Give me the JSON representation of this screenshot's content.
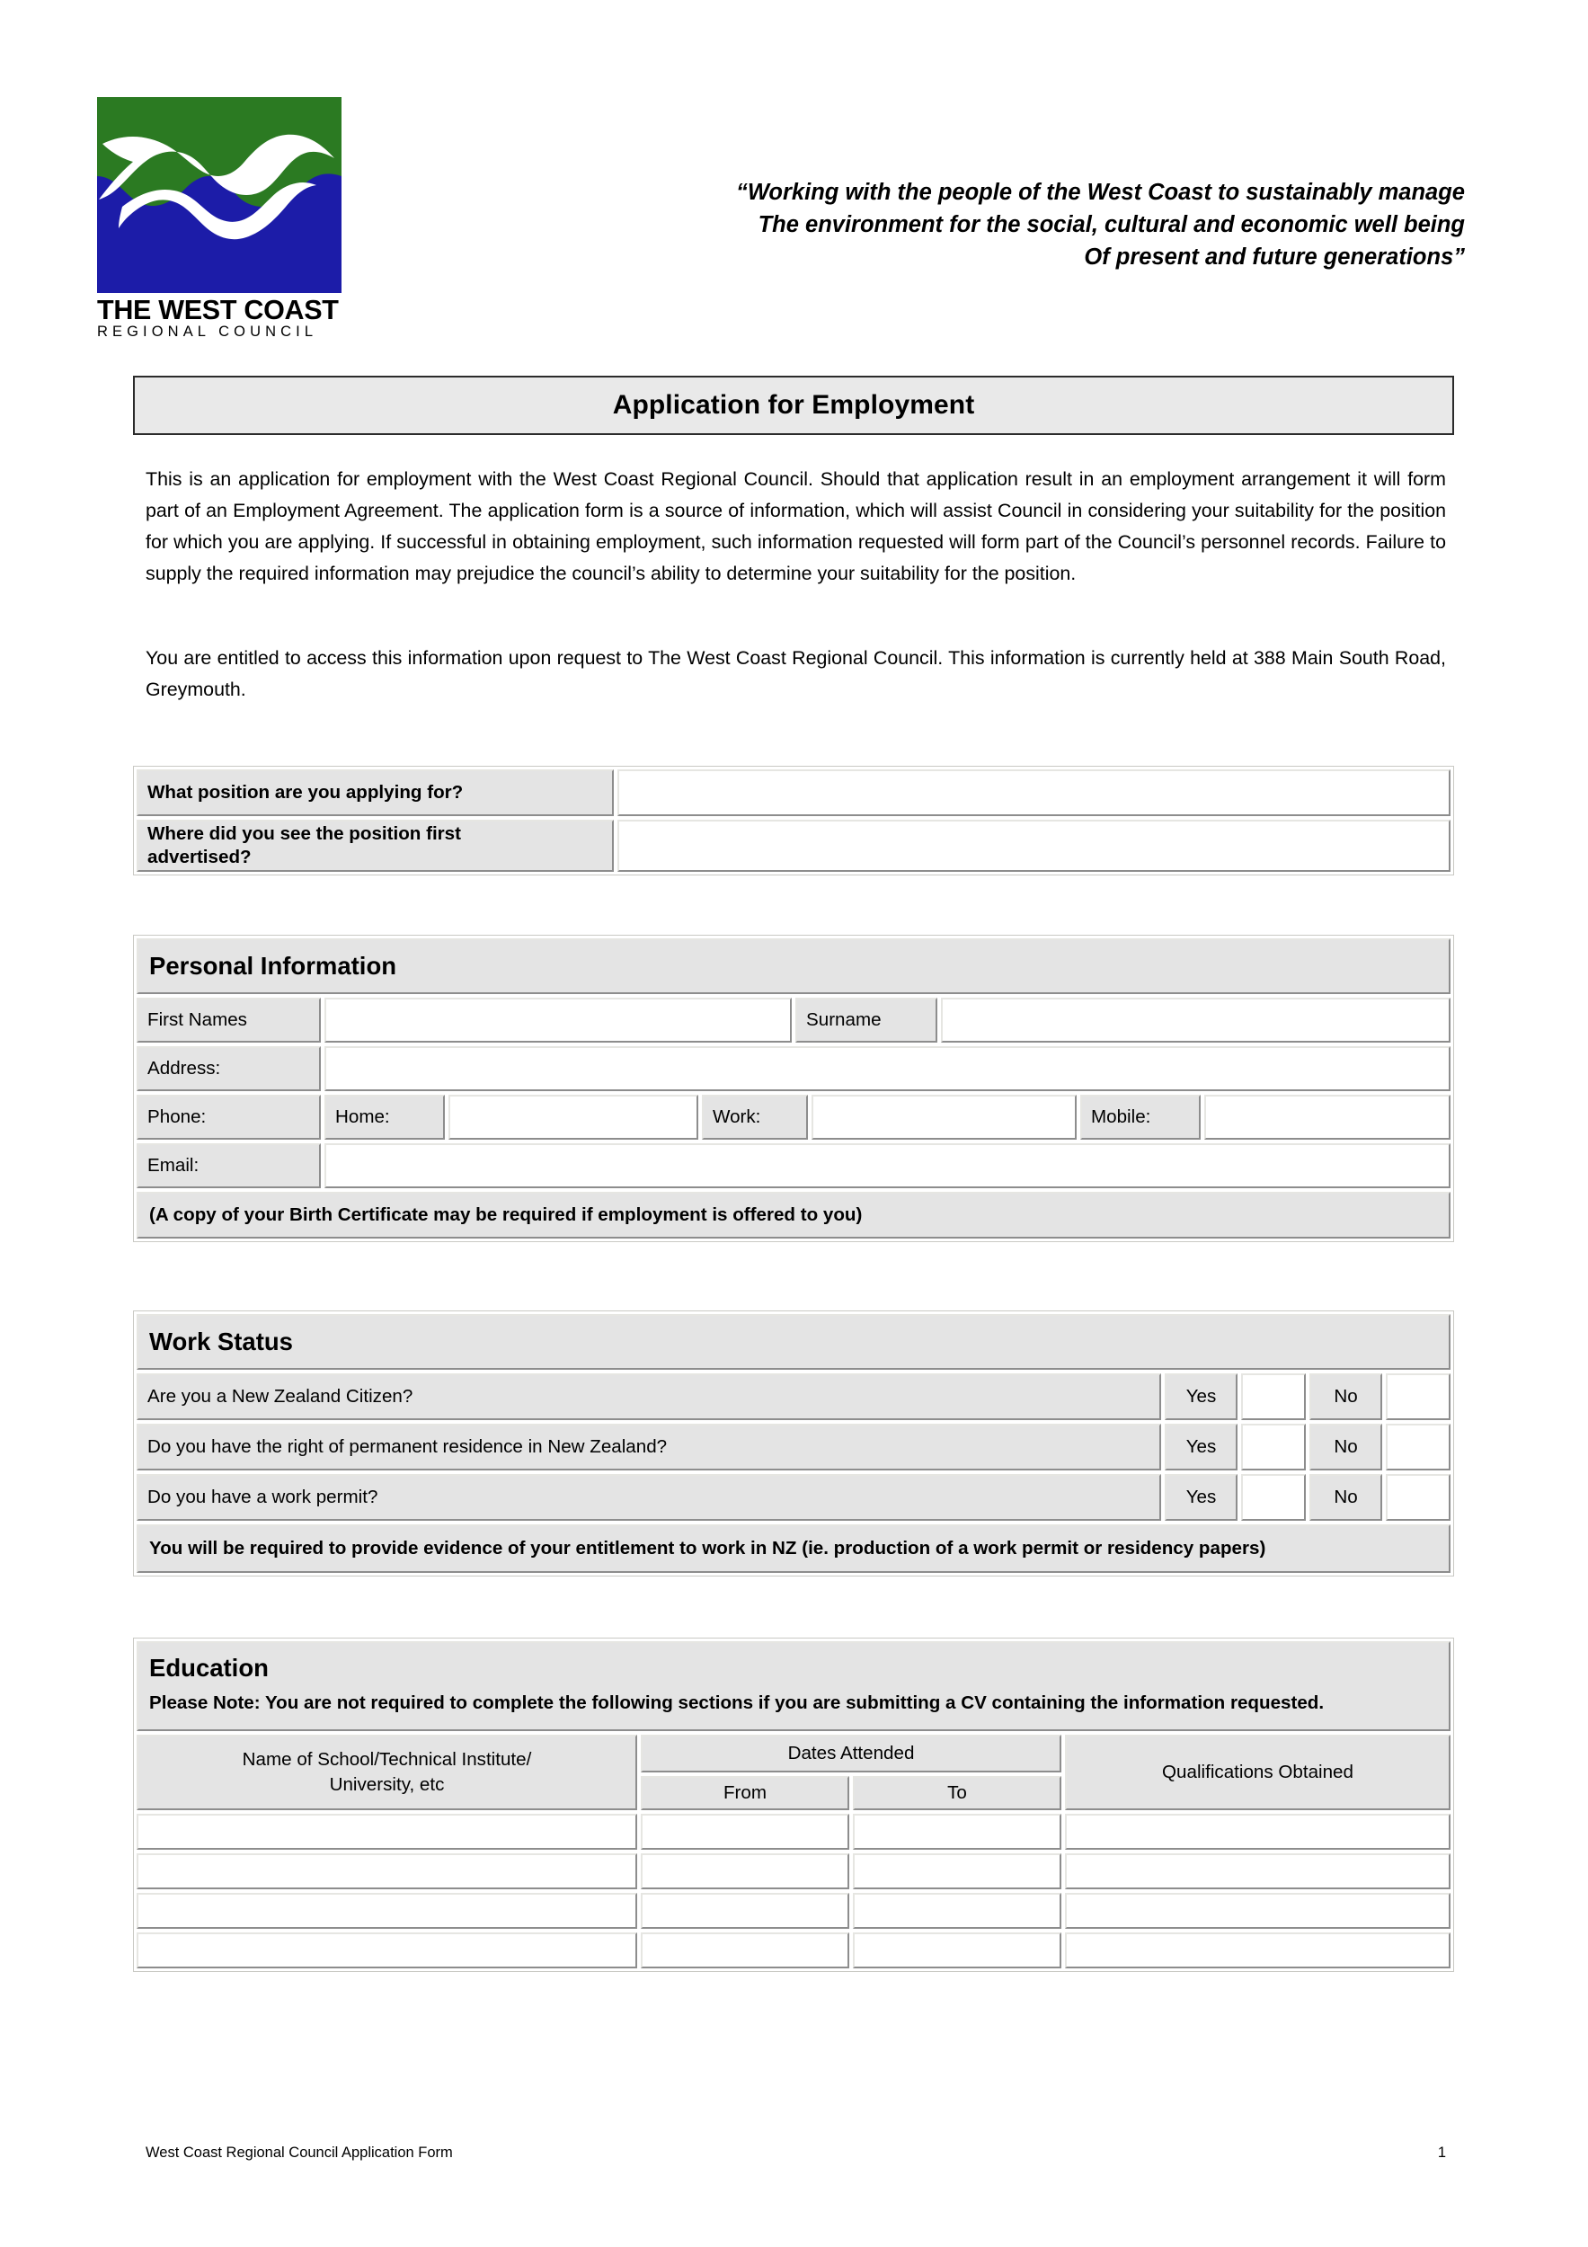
{
  "header": {
    "logo": {
      "line1": "THE WEST COAST",
      "line2": "REGIONAL COUNCIL",
      "green": "#2b7a22",
      "blue": "#1c1ca8"
    },
    "tagline": [
      "“Working with the people of the West Coast to sustainably manage",
      "The environment for the social, cultural and economic well being",
      "Of present and future generations”"
    ]
  },
  "title": "Application for Employment",
  "intro": {
    "p1": "This is an application for employment with the West Coast Regional Council.  Should that application result in an employment arrangement it will form part of an Employment Agreement.  The application form is a source of information, which will assist Council in considering your suitability for the position for which you are applying.  If successful in obtaining employment, such information requested will form part of the Council’s personnel records.  Failure to supply the required information may prejudice the council’s ability to determine your suitability for the position.",
    "p2": "You are entitled to access this information upon request to The West Coast Regional Council.  This information is currently held at 388 Main South Road, Greymouth."
  },
  "position_section": {
    "rows": [
      {
        "label": "What position are you applying for?",
        "value": ""
      },
      {
        "label_line1": "Where did you see the position first",
        "label_line2": "advertised?",
        "value": ""
      }
    ]
  },
  "personal": {
    "heading": "Personal Information",
    "first_names_label": "First Names",
    "first_names_value": "",
    "surname_label": "Surname",
    "surname_value": "",
    "address_label": "Address:",
    "address_value": "",
    "phone_label": "Phone:",
    "home_label": "Home:",
    "home_value": "",
    "work_label": "Work:",
    "work_value": "",
    "mobile_label": "Mobile:",
    "mobile_value": "",
    "email_label": "Email:",
    "email_value": "",
    "note": "(A copy of your Birth Certificate may be required if employment is offered to you)"
  },
  "work_status": {
    "heading": "Work Status",
    "yes_label": "Yes",
    "no_label": "No",
    "questions": [
      "Are you a New Zealand Citizen?",
      "Do you have the right of permanent residence in New Zealand?",
      "Do you have a work permit?"
    ],
    "note": "You will be required to provide evidence of your entitlement to work in NZ (ie. production of a work permit or residency papers)"
  },
  "education": {
    "heading": "Education",
    "note": "Please Note: You are not required to complete the following sections if you are submitting a CV containing the information requested.",
    "columns": {
      "name_line1": "Name of School/Technical Institute/",
      "name_line2": "University, etc",
      "dates_attended": "Dates Attended",
      "from": "From",
      "to": "To",
      "qualifications": "Qualifications Obtained"
    },
    "rows": [
      {
        "name": "",
        "from": "",
        "to": "",
        "qualifications": ""
      },
      {
        "name": "",
        "from": "",
        "to": "",
        "qualifications": ""
      },
      {
        "name": "",
        "from": "",
        "to": "",
        "qualifications": ""
      },
      {
        "name": "",
        "from": "",
        "to": "",
        "qualifications": ""
      }
    ]
  },
  "footer": {
    "left": "West Coast Regional Council Application Form",
    "page_number": "1"
  }
}
